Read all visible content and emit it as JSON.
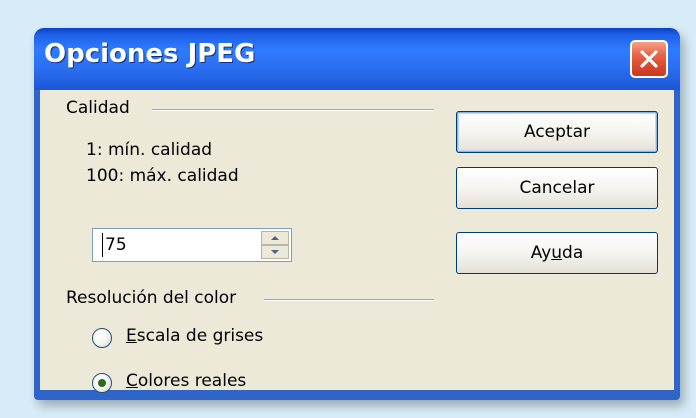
{
  "window": {
    "title": "Opciones JPEG",
    "close_icon": "close-icon"
  },
  "quality": {
    "group_label": "Calidad",
    "min_text": "1: mín. calidad",
    "max_text": "100: máx. calidad",
    "value": "75"
  },
  "color_resolution": {
    "group_label": "Resolución del color",
    "options": [
      {
        "label_mn": "E",
        "label_rest": "scala de grises",
        "selected": false
      },
      {
        "label_mn": "C",
        "label_rest": "olores reales",
        "selected": true
      }
    ]
  },
  "buttons": {
    "accept": "Aceptar",
    "cancel": "Cancelar",
    "help_pre": "Ay",
    "help_mn": "u",
    "help_post": "da"
  },
  "colors": {
    "titlebar": "#2c6ff2",
    "client_bg": "#ece9d8",
    "close_red": "#d84a2e"
  }
}
